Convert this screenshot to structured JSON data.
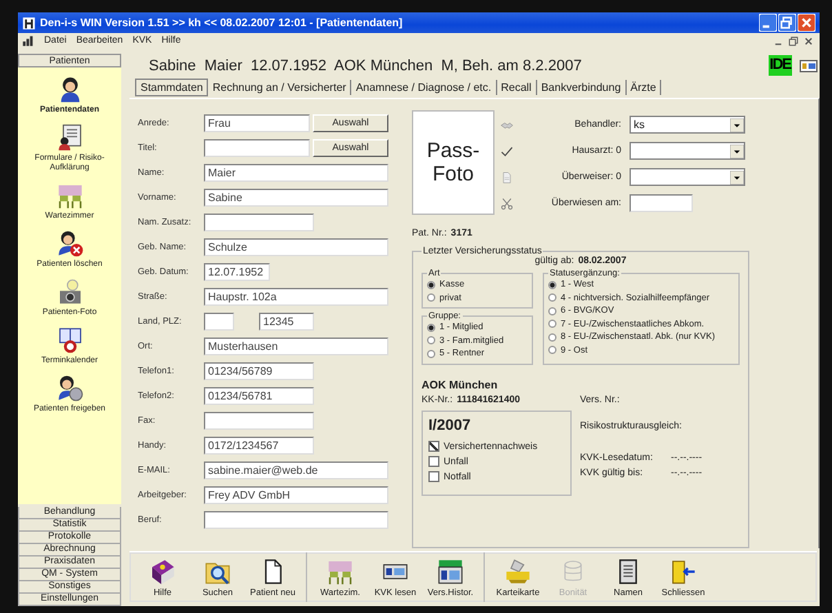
{
  "window": {
    "title": "Den-i-s WIN Version 1.51 >> kh << 08.02.2007  12:01 - [Patientendaten]"
  },
  "menu": [
    "Datei",
    "Bearbeiten",
    "KVK",
    "Hilfe"
  ],
  "sidebar": {
    "header": "Patienten",
    "items": [
      {
        "label": "Patientendaten",
        "kind": "person",
        "selected": true
      },
      {
        "label": "Formulare / Risiko-Aufklärung",
        "kind": "form",
        "selected": false
      },
      {
        "label": "Wartezimmer",
        "kind": "chairs",
        "selected": false
      },
      {
        "label": "Patienten löschen",
        "kind": "delete",
        "selected": false
      },
      {
        "label": "Patienten-Foto",
        "kind": "camera",
        "selected": false
      },
      {
        "label": "Terminkalender",
        "kind": "calendar",
        "selected": false
      },
      {
        "label": "Patienten freigeben",
        "kind": "release",
        "selected": false
      }
    ],
    "sections": [
      "Behandlung",
      "Statistik",
      "Protokolle",
      "Abrechnung",
      "Praxisdaten",
      "QM - System",
      "Sonstiges",
      "Einstellungen"
    ]
  },
  "patient_header": "Sabine  Maier  12.07.1952  AOK München  M, Beh. am 8.2.2007",
  "logo": "IDE",
  "tabs": [
    {
      "label": "Stammdaten",
      "selected": true
    },
    {
      "label": "Rechnung an / Versicherter",
      "selected": false
    },
    {
      "label": "Anamnese / Diagnose / etc.",
      "selected": false
    },
    {
      "label": "Recall",
      "selected": false
    },
    {
      "label": "Bankverbindung",
      "selected": false
    },
    {
      "label": "Ärzte",
      "selected": false
    }
  ],
  "fields": [
    {
      "label": "Anrede:",
      "kind": "button",
      "value": "Frau",
      "button": "Auswahl"
    },
    {
      "label": "Titel:",
      "kind": "button",
      "button": "Auswahl"
    },
    {
      "label": "Name:",
      "kind": "full",
      "value": "Maier"
    },
    {
      "label": "Vorname:",
      "kind": "full",
      "value": "Sabine"
    },
    {
      "label": "Nam. Zusatz:",
      "kind": "half"
    },
    {
      "label": "Geb. Name:",
      "kind": "full",
      "value": "Schulze"
    },
    {
      "label": "Geb. Datum:",
      "kind": "date",
      "value": "12.07.1952"
    },
    {
      "label": "Straße:",
      "kind": "full",
      "value": "Haupstr. 102a"
    },
    {
      "label": "Land, PLZ:",
      "kind": "pair",
      "value2": "12345"
    },
    {
      "label": "Ort:",
      "kind": "full",
      "value": "Musterhausen"
    },
    {
      "label": "Telefon1:",
      "kind": "half",
      "value": "01234/56789"
    },
    {
      "label": "Telefon2:",
      "kind": "half",
      "value": "01234/56781"
    },
    {
      "label": "Fax:",
      "kind": "half"
    },
    {
      "label": "Handy:",
      "kind": "half",
      "value": "0172/1234567"
    },
    {
      "label": "E-MAIL:",
      "kind": "full",
      "value": "sabine.maier@web.de"
    },
    {
      "label": "Arbeitgeber:",
      "kind": "full",
      "value": "Frey ADV GmbH"
    },
    {
      "label": "Beruf:",
      "kind": "full"
    }
  ],
  "photo": "Pass-Foto",
  "doctors": [
    {
      "label": "Behandler:",
      "kind": "select",
      "value": "ks"
    },
    {
      "label": "Hausarzt: 0",
      "kind": "select"
    },
    {
      "label": "Überweiser: 0",
      "kind": "select"
    },
    {
      "label": "Überwiesen am:",
      "kind": "date"
    }
  ],
  "pat_nr": {
    "label": "Pat. Nr.:",
    "value": "3171"
  },
  "insurance": {
    "title": "Letzter Versicherungsstatus",
    "valid_label": "gültig ab:",
    "valid_date": "08.02.2007",
    "art": {
      "title": "Art",
      "options": [
        {
          "label": "Kasse",
          "selected": true
        },
        {
          "label": "privat",
          "selected": false
        }
      ]
    },
    "gruppe": {
      "title": "Gruppe:",
      "options": [
        {
          "label": "1 - Mitglied",
          "selected": true
        },
        {
          "label": "3 - Fam.mitglied",
          "selected": false
        },
        {
          "label": "5 - Rentner",
          "selected": false
        }
      ]
    },
    "status": {
      "title": "Statusergänzung:",
      "options": [
        {
          "label": "1 - West",
          "selected": true
        },
        {
          "label": "4 - nichtversich. Sozialhilfeempfänger",
          "selected": false
        },
        {
          "label": "6 - BVG/KOV",
          "selected": false
        },
        {
          "label": "7 - EU-/Zwischenstaatliches Abkom.",
          "selected": false
        },
        {
          "label": "8 - EU-/Zwischenstaatl. Abk. (nur KVK)",
          "selected": false
        },
        {
          "label": "9 - Ost",
          "selected": false
        }
      ]
    },
    "insurer": "AOK München",
    "kk_label": "KK-Nr.:",
    "kk_value": "111841621400",
    "vers_label": "Vers. Nr.:",
    "quarter": {
      "title": "I/2007",
      "checks": [
        {
          "label": "Versichertennachweis",
          "checked": true
        },
        {
          "label": "Unfall",
          "checked": false
        },
        {
          "label": "Notfall",
          "checked": false
        }
      ]
    },
    "info": [
      {
        "label": "Risikostrukturausgleich:"
      },
      {
        "label": "KVK-Lesedatum:",
        "value": "--.--.----"
      },
      {
        "label": "KVK gültig bis:",
        "value": "--.--.----"
      }
    ]
  },
  "toolbar": [
    {
      "buttons": [
        {
          "label": "Hilfe",
          "kind": "book",
          "disabled": false
        },
        {
          "label": "Suchen",
          "kind": "search",
          "disabled": false
        },
        {
          "label": "Patient neu",
          "kind": "page",
          "disabled": false
        }
      ]
    },
    {
      "buttons": [
        {
          "label": "Wartezim.",
          "kind": "chairs",
          "disabled": false
        },
        {
          "label": "KVK lesen",
          "kind": "card",
          "disabled": false
        },
        {
          "label": "Vers.Histor.",
          "kind": "history",
          "disabled": false
        }
      ]
    },
    {
      "buttons": [
        {
          "label": "Karteikarte",
          "kind": "printer",
          "disabled": false
        },
        {
          "label": "Bonität",
          "kind": "coins",
          "disabled": true
        },
        {
          "label": "Namen",
          "kind": "list",
          "disabled": false
        },
        {
          "label": "Schliessen",
          "kind": "exit",
          "disabled": false
        }
      ]
    }
  ]
}
